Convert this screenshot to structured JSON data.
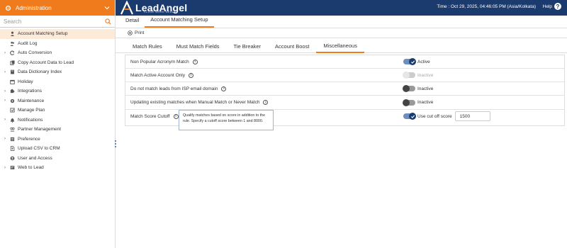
{
  "sidebar": {
    "header_title": "Administration",
    "search_placeholder": "Search",
    "items": [
      {
        "label": "Account Matching Setup",
        "icon": "user-gear-icon",
        "expandable": false,
        "active": true
      },
      {
        "label": "Audit Log",
        "icon": "users-icon",
        "expandable": false
      },
      {
        "label": "Auto Conversion",
        "icon": "refresh-icon",
        "expandable": true
      },
      {
        "label": "Copy Account Data to Lead",
        "icon": "copy-icon",
        "expandable": false
      },
      {
        "label": "Data Dictionary Index",
        "icon": "book-icon",
        "expandable": true
      },
      {
        "label": "Holiday",
        "icon": "calendar-icon",
        "expandable": false
      },
      {
        "label": "Integrations",
        "icon": "puzzle-icon",
        "expandable": true
      },
      {
        "label": "Maintenance",
        "icon": "wrench-icon",
        "expandable": true
      },
      {
        "label": "Manage Plan",
        "icon": "plan-icon",
        "expandable": false
      },
      {
        "label": "Notifications",
        "icon": "bell-icon",
        "expandable": true
      },
      {
        "label": "Partner Management",
        "icon": "partner-icon",
        "expandable": false
      },
      {
        "label": "Preference",
        "icon": "preference-icon",
        "expandable": true
      },
      {
        "label": "Upload CSV to CRM",
        "icon": "file-upload-icon",
        "expandable": false
      },
      {
        "label": "User and Access",
        "icon": "user-circle-icon",
        "expandable": false
      },
      {
        "label": "Web to Lead",
        "icon": "globe-icon",
        "expandable": true
      }
    ]
  },
  "topbar": {
    "logo_text": "LeadAngel",
    "logo_tagline": "CLOSE MORE DEALS",
    "time_text": "Time : Oct 29, 2025, 04:46:05 PM (Asia/Kolkata)",
    "help_label": "Help",
    "help_icon": "question-circle-icon"
  },
  "tabs": [
    "Detail",
    "Account Matching Setup"
  ],
  "toolbar": {
    "print_label": "Print"
  },
  "subtabs": [
    "Match Rules",
    "Must Match Fields",
    "Tie Breaker",
    "Account Boost",
    "Miscellaneous"
  ],
  "settings": [
    {
      "label": "Non Popular Acronym Match",
      "state": "on",
      "status": "Active"
    },
    {
      "label": "Match Active Account Only",
      "state": "disabled",
      "status": "Inactive"
    },
    {
      "label": "Do not match leads from ISP email domain",
      "state": "off",
      "status": "Inactive"
    },
    {
      "label": "Updating existing matches when Manual Match or Never Match",
      "state": "off",
      "status": "Inactive"
    },
    {
      "label": "Match Score Cutoff",
      "state": "on",
      "status": "Use cut off score",
      "score_value": "1500"
    }
  ],
  "tooltip": {
    "text": "Qualify matches based on score in addition to the rule. Specify a cutoff score between 1 and 8000."
  },
  "colors": {
    "accent": "#f07b1d",
    "navy": "#1b3b6f"
  }
}
